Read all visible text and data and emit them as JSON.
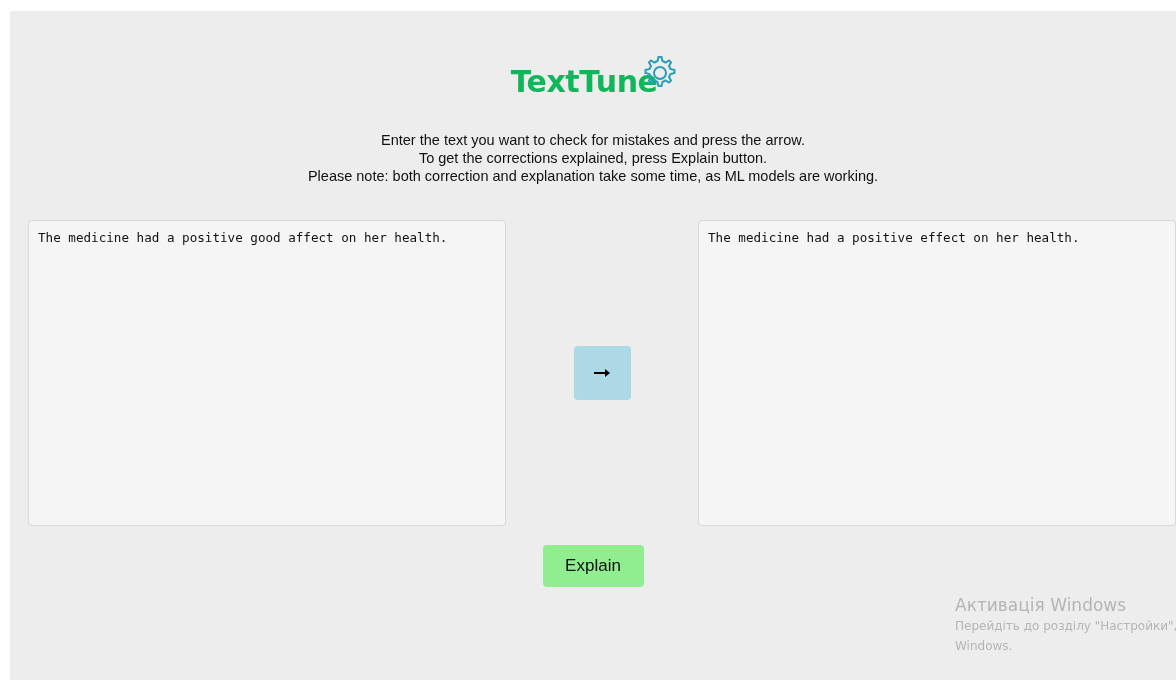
{
  "logo": {
    "text": "TextTune"
  },
  "instructions": [
    "Enter the text you want to check for mistakes and press the arrow.",
    "To get the corrections explained, press Explain button.",
    "Please note: both correction and explanation take some time, as ML models are working."
  ],
  "input": {
    "value": "The medicine had a positive good affect on her health."
  },
  "output": {
    "value": "The medicine had a positive effect on her health."
  },
  "explain_button": {
    "label": "Explain"
  },
  "activation_notice": {
    "title": "Активація Windows",
    "text": "Перейдіть до розділу \"Настройки\",",
    "text_2": "Windows."
  }
}
